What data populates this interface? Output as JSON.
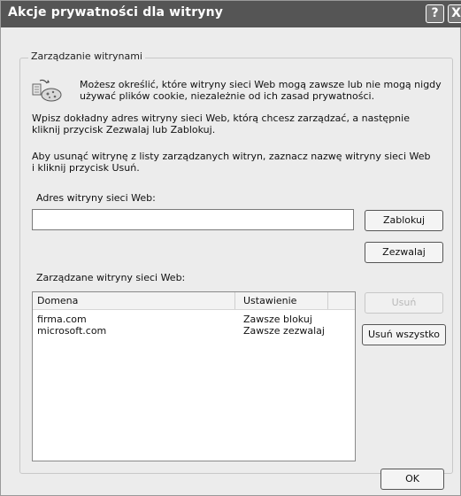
{
  "window": {
    "title": "Akcje prywatności dla witryny",
    "help_glyph": "?",
    "close_glyph": "X"
  },
  "group": {
    "legend": "Zarządzanie witrynami"
  },
  "info": {
    "line1": "Możesz określić, które witryny sieci Web mogą zawsze lub nie mogą nigdy",
    "line2": "używać plików cookie, niezależnie od ich zasad prywatności."
  },
  "instructions": {
    "p1_line1": "Wpisz dokładny adres witryny sieci Web, którą chcesz zarządzać, a następnie",
    "p1_line2": "kliknij przycisk Zezwalaj lub Zablokuj.",
    "p2_line1": "Aby usunąć witrynę z listy zarządzanych witryn, zaznacz nazwę witryny sieci Web",
    "p2_line2": "i kliknij przycisk Usuń."
  },
  "address": {
    "label": "Adres witryny sieci Web:",
    "value": ""
  },
  "buttons": {
    "block": "Zablokuj",
    "allow": "Zezwalaj",
    "remove": "Usuń",
    "remove_all": "Usuń wszystko",
    "ok": "OK"
  },
  "managed": {
    "label": "Zarządzane witryny sieci Web:",
    "columns": [
      "Domena",
      "Ustawienie"
    ],
    "rows": [
      {
        "domain": "firma.com",
        "setting": "Zawsze blokuj"
      },
      {
        "domain": "microsoft.com",
        "setting": "Zawsze zezwalaj"
      }
    ]
  },
  "colors": {
    "titlebar": "#555555",
    "dialog_bg": "#ececec"
  }
}
